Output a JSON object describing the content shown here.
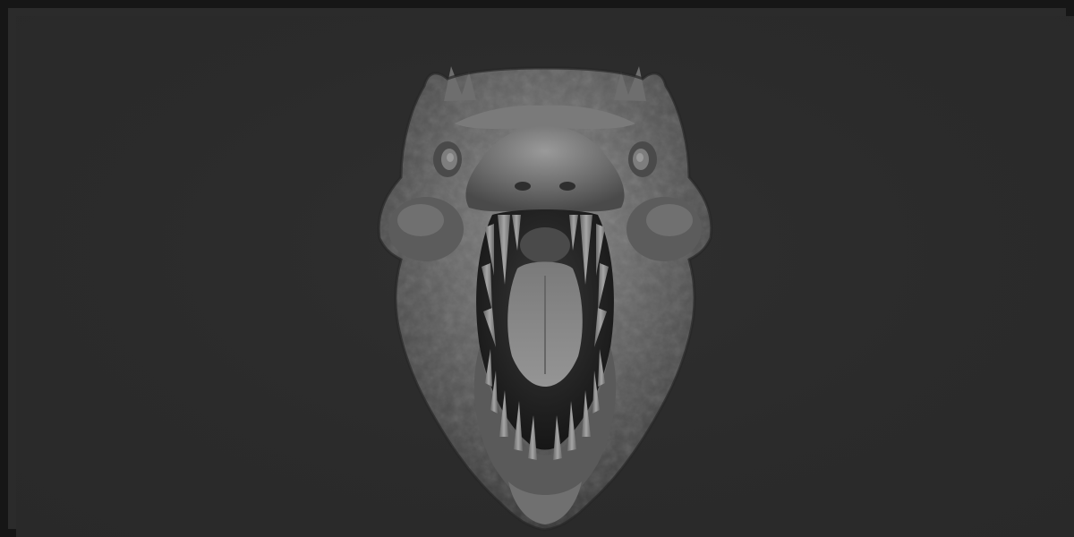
{
  "scene": {
    "subject_icon": "dinosaur-head-sculpt-icon",
    "colors": {
      "background": "#2b2b2b",
      "border": "#161616",
      "clay_light": "#8c8c8c",
      "clay_mid": "#5e5e5e",
      "clay_dark": "#2e2e2e",
      "mouth_dark": "#1c1c1c",
      "teeth": "#9a9a9a"
    }
  }
}
